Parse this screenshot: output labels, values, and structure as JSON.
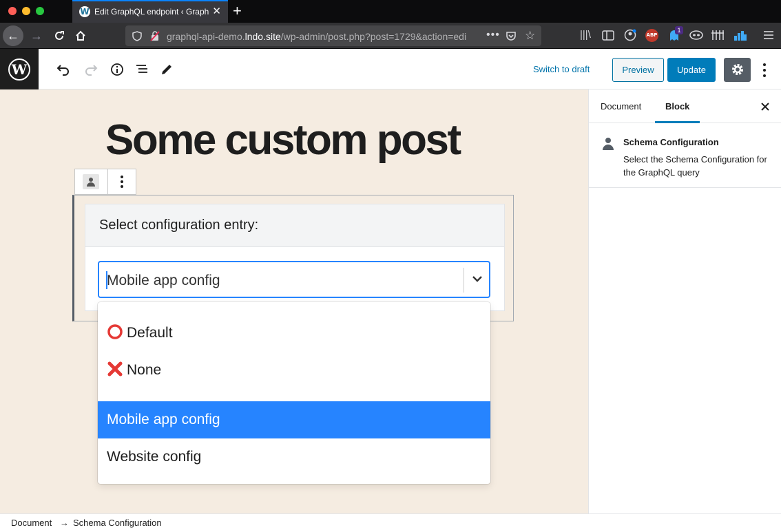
{
  "browser": {
    "tab_title": "Edit GraphQL endpoint ‹ Graph",
    "url_prefix": "graphql-api-demo.",
    "url_domain": "lndo.site",
    "url_path": "/wp-admin/post.php?post=1729&action=edi",
    "addon_badge": "1",
    "abp_label": "ABP",
    "colors": {
      "tab_accent": "#0a84ff",
      "tabbar": "#0c0c0d",
      "navbar": "#323234"
    }
  },
  "editor": {
    "switch_to_draft": "Switch to draft",
    "preview": "Preview",
    "update": "Update",
    "colors": {
      "primary": "#007cba",
      "settings_active": "#555d66"
    }
  },
  "post": {
    "title": "Some custom post"
  },
  "block": {
    "header": "Select configuration entry:",
    "selected_value": "Mobile app config",
    "options": [
      {
        "icon": "hollow-red-circle-icon",
        "label": "Default",
        "selected": false
      },
      {
        "icon": "red-cross-mark-icon",
        "label": "None",
        "selected": false
      },
      {
        "icon": "",
        "label": "Mobile app config",
        "selected": true
      },
      {
        "icon": "",
        "label": "Website config",
        "selected": false
      }
    ],
    "colors": {
      "focus": "#2684ff"
    }
  },
  "sidebar": {
    "tabs": [
      {
        "label": "Document",
        "active": false
      },
      {
        "label": "Block",
        "active": true
      }
    ],
    "block_name": "Schema Configuration",
    "block_description": "Select the Schema Configuration for the GraphQL query"
  },
  "breadcrumb": {
    "items": [
      "Document",
      "Schema Configuration"
    ],
    "separator": "→"
  }
}
